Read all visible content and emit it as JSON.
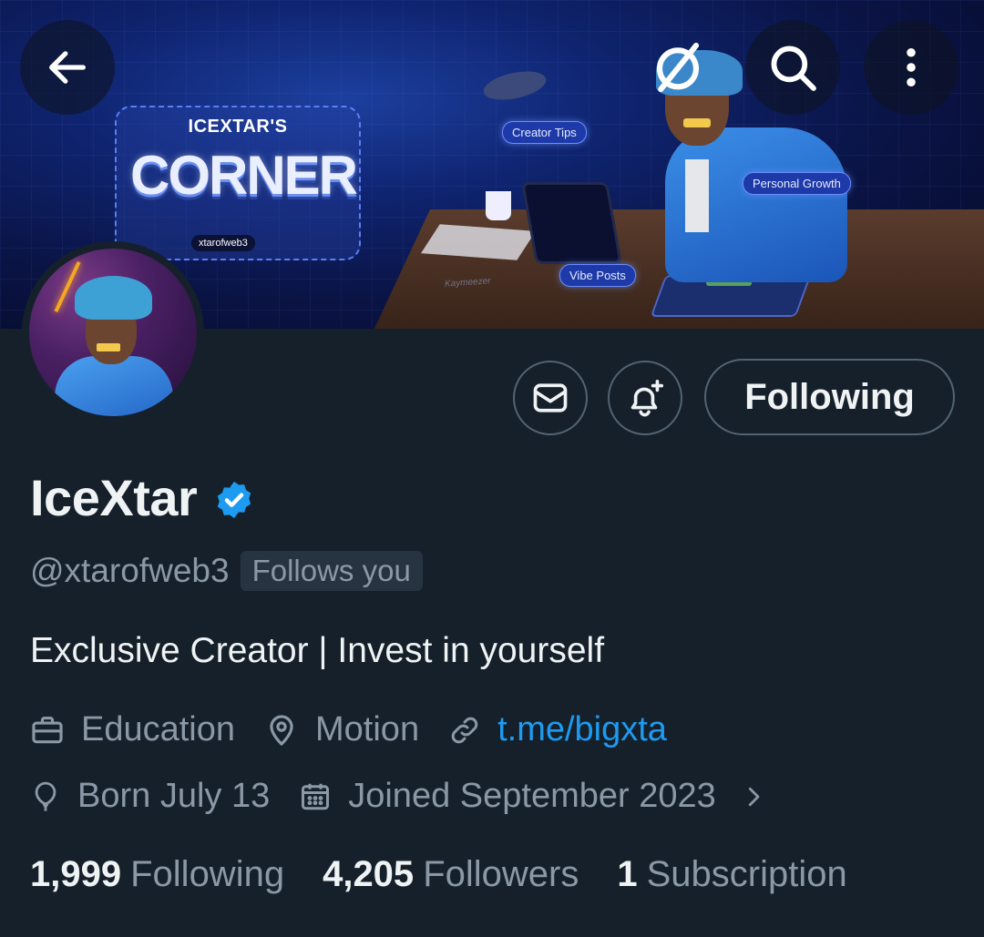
{
  "banner": {
    "logo_small": "ICEXTAR'S",
    "logo_big": "CORNER",
    "logo_handle": "xtarofweb3",
    "tags": [
      "Creator Tips",
      "Personal Growth",
      "Vibe Posts"
    ],
    "signature": "Kaymeezer"
  },
  "topbar": {
    "back_icon": "arrow-left-icon",
    "circle_icon": "no-circle-icon",
    "search_icon": "search-icon",
    "more_icon": "more-vertical-icon"
  },
  "actions": {
    "message_icon": "envelope-icon",
    "notify_icon": "bell-plus-icon",
    "following_label": "Following"
  },
  "profile": {
    "name": "IceXtar",
    "handle": "@xtarofweb3",
    "follows_you": "Follows you",
    "bio": "Exclusive Creator | Invest in yourself",
    "category": "Education",
    "location": "Motion",
    "link": "t.me/bigxta",
    "birthday": "Born July 13",
    "joined": "Joined September 2023"
  },
  "stats": {
    "following_count": "1,999",
    "following_label": "Following",
    "followers_count": "4,205",
    "followers_label": "Followers",
    "subscriptions_count": "1",
    "subscriptions_label": "Subscription"
  },
  "colors": {
    "background": "#15202b",
    "accent": "#1d9bf0",
    "secondary_text": "#8b98a5",
    "border": "#536471"
  }
}
